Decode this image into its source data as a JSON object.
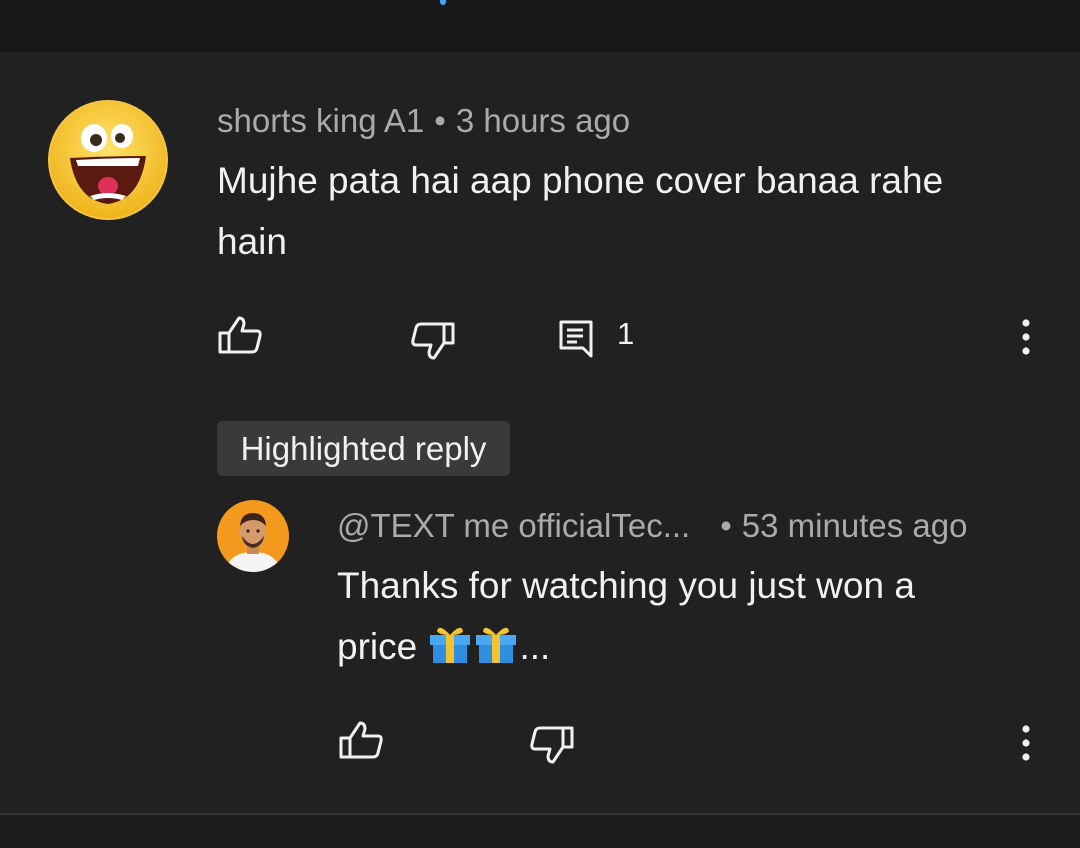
{
  "comment": {
    "author": "shorts king A1",
    "separator": "•",
    "time": "3 hours ago",
    "text_line1": "Mujhe pata hai aap phone cover banaa rahe",
    "text_line2": "hain",
    "reply_count": "1",
    "icons": {
      "like": "thumbs-up-icon",
      "dislike": "thumbs-down-icon",
      "reply": "comment-icon",
      "more": "more-vertical-icon"
    }
  },
  "highlight_badge": "Highlighted reply",
  "reply": {
    "author": "@TEXT me officialTec...",
    "separator": "•",
    "time": "53 minutes ago",
    "text_line1": "Thanks for watching you just won a",
    "text_line2_prefix": "price",
    "text_line2_suffix": "...",
    "icons": {
      "like": "thumbs-up-icon",
      "dislike": "thumbs-down-icon",
      "gift": "gift-emoji",
      "more": "more-vertical-icon"
    }
  },
  "colors": {
    "background": "#212121",
    "meta_text": "#aaaaaa",
    "primary_text": "#f1f1f1",
    "badge_bg": "#3a3a3a"
  }
}
